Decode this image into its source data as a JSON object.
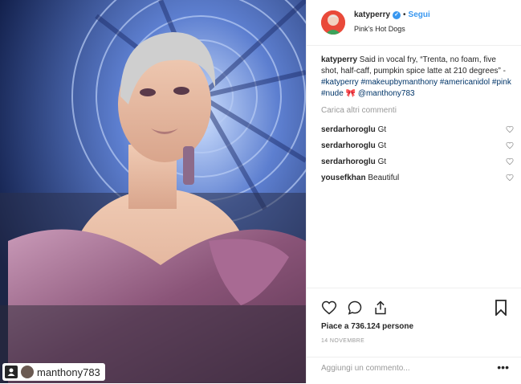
{
  "post": {
    "photo_tag_user": "manthony783"
  },
  "header": {
    "username": "katyperry",
    "separator": "•",
    "follow_label": "Segui",
    "location": "Pink's Hot Dogs"
  },
  "caption": {
    "username": "katyperry",
    "text": " Said in vocal fry, “Trenta, no foam, five shot, half-caff, pumpkin spice latte at 210 degrees” - ",
    "tags": [
      "#katyperry",
      "#makeupbymanthony",
      "#americanidol",
      "#pink",
      "#nude",
      "🎀",
      "@manthony783"
    ]
  },
  "load_more": "Carica altri commenti",
  "comments": [
    {
      "user": "serdarhoroglu",
      "text": "Gt"
    },
    {
      "user": "serdarhoroglu",
      "text": "Gt"
    },
    {
      "user": "serdarhoroglu",
      "text": "Gt"
    },
    {
      "user": "yousefkhan",
      "text": "Beautiful"
    }
  ],
  "likes": "Piace a 736.124 persone",
  "date": "14 NOVEMBRE",
  "add_comment_placeholder": "Aggiungi un commento...",
  "more_options": "•••",
  "colors": {
    "link": "#3897f0",
    "hashtag": "#003569",
    "muted": "#999999"
  }
}
